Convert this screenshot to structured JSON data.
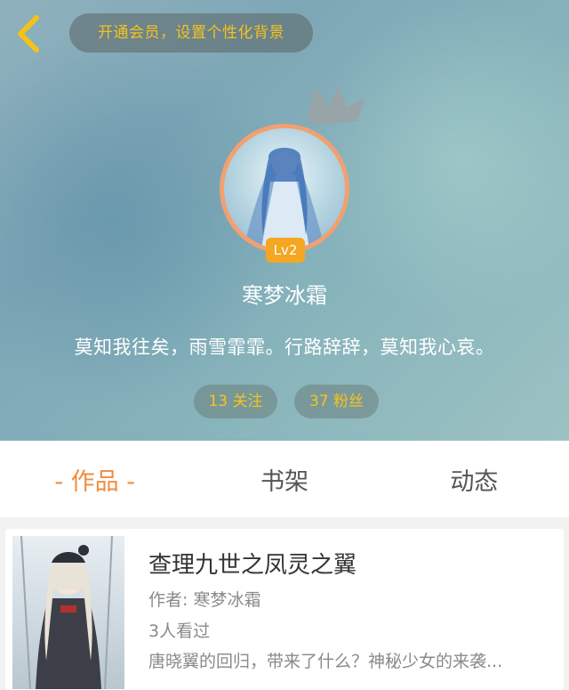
{
  "header": {
    "vip_banner": "开通会员，设置个性化背景"
  },
  "profile": {
    "level": "Lv2",
    "username": "寒梦冰霜",
    "bio": "莫知我往矣，雨雪霏霏。行路辞辞，莫知我心哀。",
    "follow_label": "13 关注",
    "fans_label": "37 粉丝"
  },
  "tabs": [
    {
      "label": "- 作品 -",
      "active": true
    },
    {
      "label": "书架",
      "active": false
    },
    {
      "label": "动态",
      "active": false
    }
  ],
  "works": [
    {
      "title": "查理九世之凤灵之翼",
      "author": "作者: 寒梦冰霜",
      "views": "3人看过",
      "description": "唐晓翼的回归，带来了什么？神秘少女的来袭..."
    }
  ],
  "colors": {
    "accent": "#f08c3c",
    "gold": "#f4c51d",
    "badge": "#f5a623",
    "back_arrow": "#f5c21b"
  }
}
